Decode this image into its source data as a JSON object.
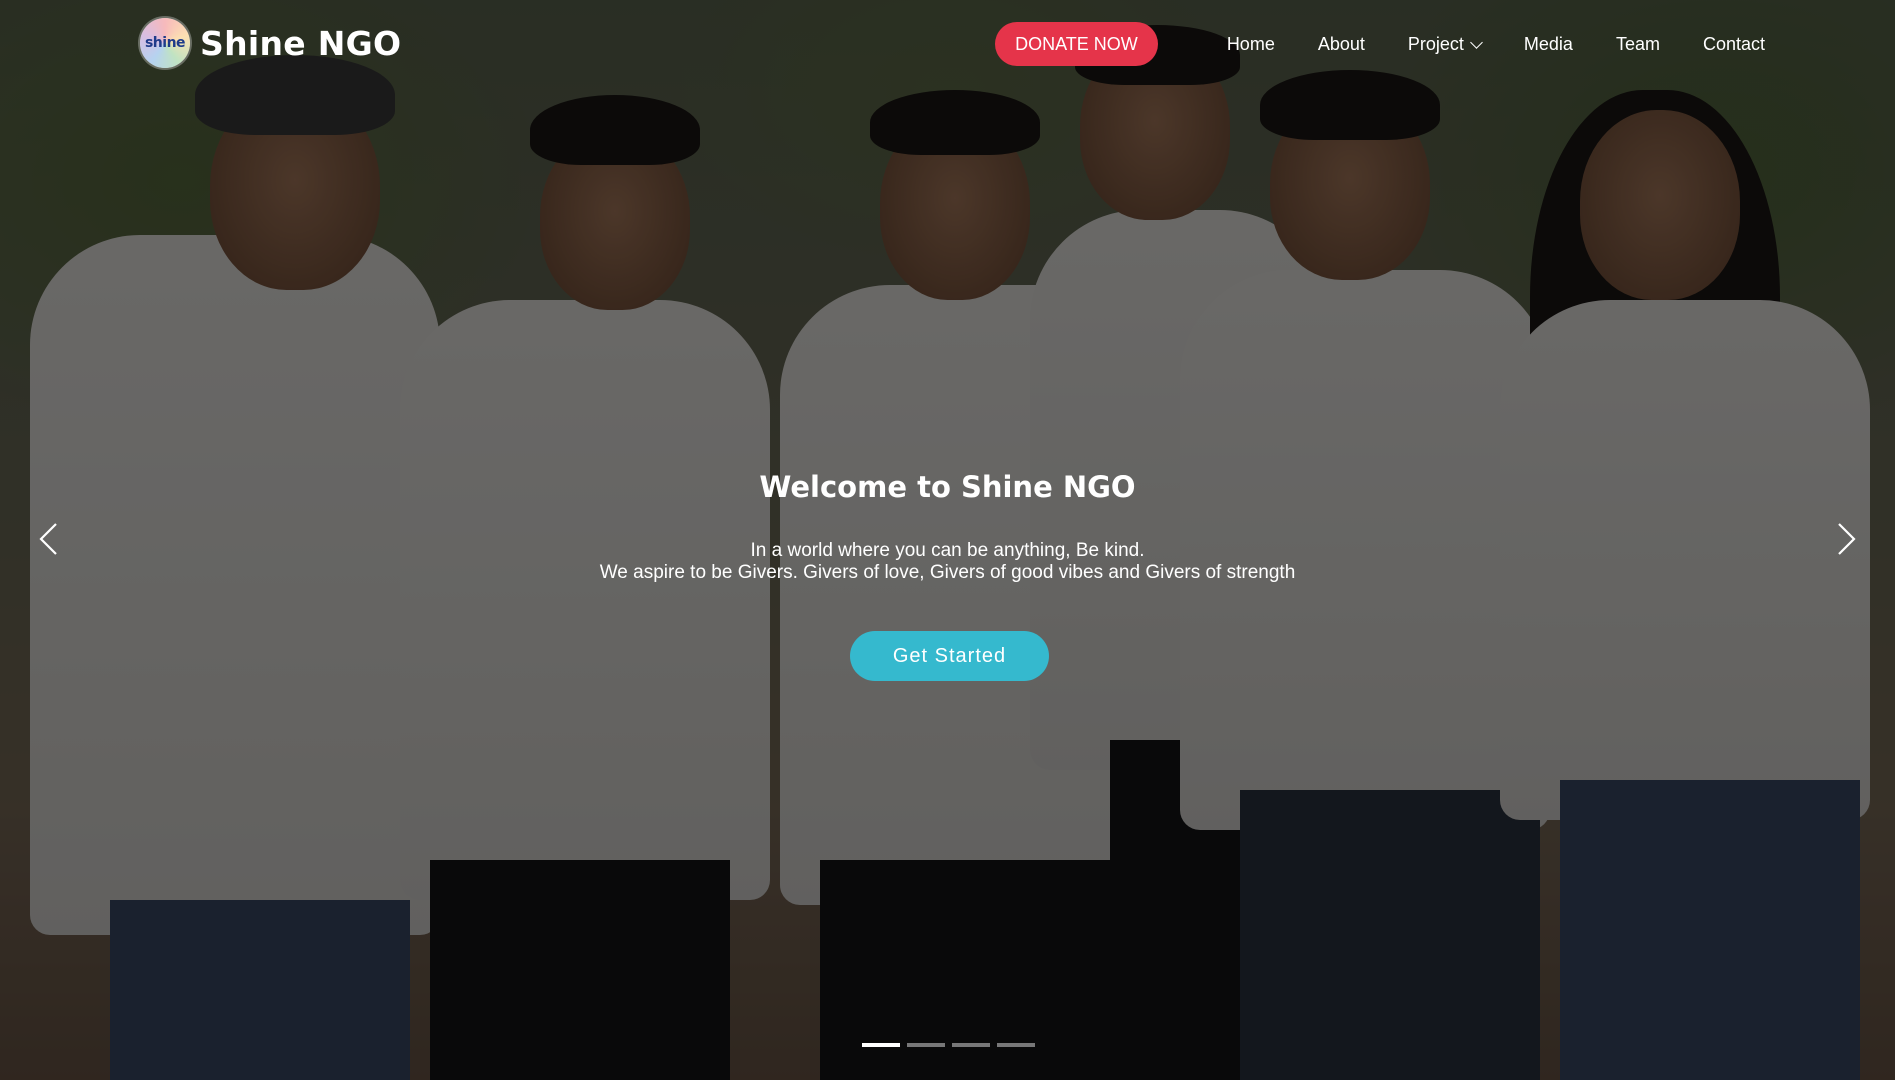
{
  "header": {
    "logo_text": "shine",
    "brand_name": "Shine NGO",
    "donate_label": "DONATE NOW",
    "nav": [
      {
        "label": "Home"
      },
      {
        "label": "About"
      },
      {
        "label": "Project"
      },
      {
        "label": "Media"
      },
      {
        "label": "Team"
      },
      {
        "label": "Contact"
      }
    ]
  },
  "hero": {
    "title": "Welcome to Shine NGO",
    "line1": "In a world where you can be anything, Be kind.",
    "line2": "We aspire to be Givers. Givers of love, Givers of good vibes and Givers of strength",
    "cta_label": "Get Started",
    "slide_count": 4,
    "active_slide": 1
  },
  "colors": {
    "donate": "#e5344a",
    "cta": "#35b9ce",
    "text": "#ffffff"
  },
  "icons": [
    "chevron-down-icon",
    "chevron-left-icon",
    "chevron-right-icon"
  ]
}
